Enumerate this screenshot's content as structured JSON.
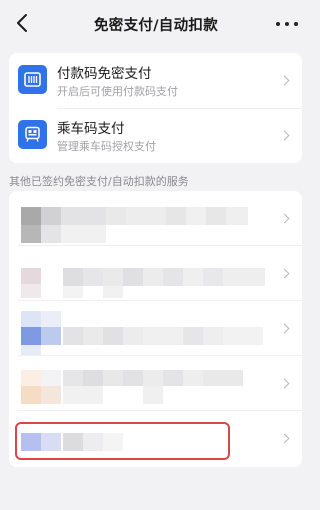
{
  "header": {
    "title": "免密支付/自动扣款",
    "back_icon": "chevron-left-icon",
    "more_icon": "more-horizontal-icon"
  },
  "payments": [
    {
      "title": "付款码免密支付",
      "subtitle": "开启后可使用付款码支付",
      "icon": "payment-code-icon"
    },
    {
      "title": "乘车码支付",
      "subtitle": "管理乘车码授权支付",
      "icon": "transit-code-icon"
    }
  ],
  "section": {
    "label": "其他已签约免密支付/自动扣款的服务"
  },
  "colors": {
    "accent": "#2f72ea",
    "highlight": "#d9474b",
    "background": "#f2f2f4"
  }
}
